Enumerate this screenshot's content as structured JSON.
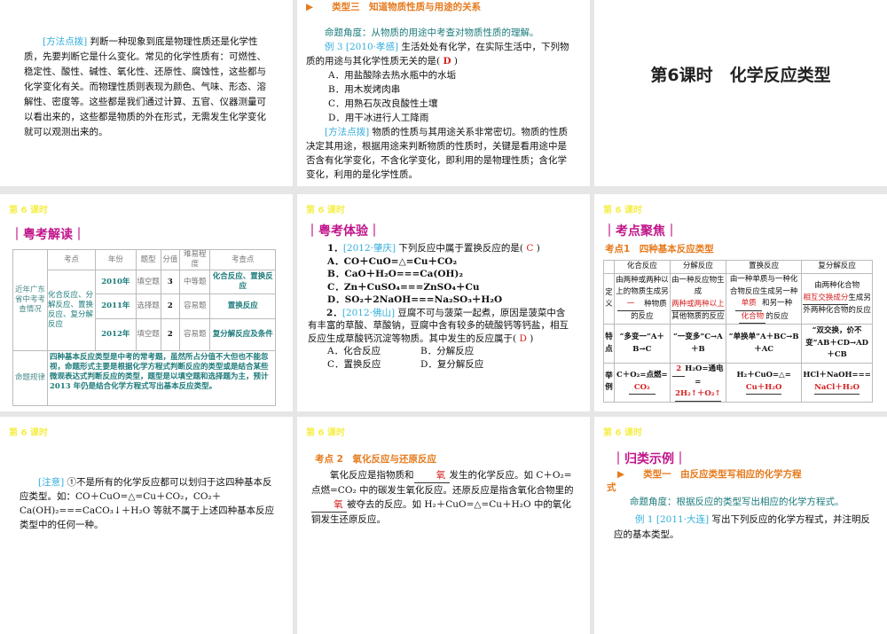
{
  "slide1": {
    "tag": "[方法点拨]",
    "text": "判断一种现象到底是物理性质还是化学性质，先要判断它是什么变化。常见的化学性质有：可燃性、稳定性、酸性、碱性、氧化性、还原性、腐蚀性，这些都与化学变化有关。而物理性质则表现为颜色、气味、形态、溶解性、密度等。这些都是我们通过计算、五官、仪器测量可以看出来的，这些都是物质的外在形式，无需发生化学变化就可以观测出来的。"
  },
  "slide2": {
    "arrow": "▶",
    "type_title": "类型三　知道物质性质与用途的关系",
    "angle": "命题角度：从物质的用途中考查对物质性质的理解。",
    "ex_tag": "例 3 [2010·孝感]",
    "ex_text": "生活处处有化学，在实际生活中，下列物质的用途与其化学性质无关的是(",
    "answer": "D",
    "close": ")",
    "options": [
      "A．用盐酸除去热水瓶中的水垢",
      "B．用木炭烤肉串",
      "C．用熟石灰改良酸性土壤",
      "D．用干冰进行人工降雨"
    ],
    "tag": "[方法点拨]",
    "method": "物质的性质与其用途关系非常密切。物质的性质决定其用途，根据用途来判断物质的性质时，关键是看用途中是否含有化学变化，不含化学变化，即利用的是物理性质；含化学变化，利用的是化学性质。"
  },
  "slide3": {
    "title": "第6课时　化学反应类型"
  },
  "header": "第 6 课时",
  "slide4": {
    "section": "｜粤考解读｜",
    "cols": [
      "考点",
      "年份",
      "题型",
      "分值",
      "难易程度",
      "考查点"
    ],
    "row_label": "近年广东省中考考查情况",
    "points": "化合反应、分解反应、置换反应、复分解反应",
    "rows": [
      [
        "2010年",
        "填空题",
        "3",
        "中等题",
        "化合反应、置换反应"
      ],
      [
        "2011年",
        "选择题",
        "2",
        "容易题",
        "置换反应"
      ],
      [
        "2012年",
        "填空题",
        "2",
        "容易题",
        "复分解反应及条件"
      ]
    ],
    "rule_label": "命题规律",
    "rule": "四种基本反应类型是中考的常考题，虽然所占分值不大但也不能忽视，命题形式主要是根据化学方程式判断反应的类型或是结合某些微观表达式判断反应的类型，题型是以填空题和选择题为主，预计 2013 年仍是结合化学方程式写出基本反应类型。"
  },
  "slide5": {
    "section": "｜粤考体验｜",
    "q1_num": "1．",
    "q1_tag": "[2012·肇庆]",
    "q1_text": "下列反应中属于置换反应的是(",
    "q1_ans": "C",
    "close": ")",
    "q1_opts": [
      "A．CO＋CuO=△=Cu＋CO₂",
      "B．CaO＋H₂O===Ca(OH)₂",
      "C．Zn＋CuSO₄===ZnSO₄＋Cu",
      "D．SO₂＋2NaOH===Na₂SO₃＋H₂O"
    ],
    "q2_num": "2．",
    "q2_tag": "[2012·佛山]",
    "q2_text": "豆腐不可与菠菜一起煮，原因是菠菜中含有丰富的草酸、草酸钠，豆腐中含有较多的硫酸钙等钙盐，相互反应生成草酸钙沉淀等物质。其中发生的反应属于(",
    "q2_ans": "D",
    "q2_opts": [
      "A．化合反应",
      "B．分解反应",
      "C．置换反应",
      "D．复分解反应"
    ]
  },
  "slide6": {
    "section": "｜考点聚焦｜",
    "sub": "考点1　四种基本反应类型",
    "cols": [
      "化合反应",
      "分解反应",
      "置换反应",
      "复分解反应"
    ],
    "row_labels": [
      "定义",
      "特点",
      "举例"
    ],
    "def": [
      [
        "由两种或两种以上的物质生成另",
        "一",
        "种物质的反应"
      ],
      [
        "由一种反应物生成",
        "两种或两种以上",
        "其他物质的反应"
      ],
      [
        "由一种单质与一种化合物反应生成另一种",
        "单质",
        "和另一种",
        "化合物",
        "的反应"
      ],
      [
        "由两种化合物",
        "相互交换成分",
        "生成另外两种化合物的反应"
      ]
    ],
    "feat": [
      "“多变一”A＋B→C",
      "“一变多”C→A＋B",
      "“单换单”A＋BC→B＋AC",
      "“双交换，价不变”AB＋CD→AD＋CB"
    ],
    "ex": [
      [
        "C＋O₂=点燃=",
        "CO₂"
      ],
      [
        "2",
        "H₂O=通电=",
        "2H₂↑＋O₂↑"
      ],
      [
        "H₂＋CuO=△=",
        "Cu＋H₂O"
      ],
      [
        "HCl＋NaOH===",
        "NaCl＋H₂O"
      ]
    ]
  },
  "slide7": {
    "tag": "[注意]",
    "text": "①不是所有的化学反应都可以划归于这四种基本反应类型。如：CO＋CuO=△=Cu＋CO₂，CO₂＋Ca(OH)₂===CaCO₃↓＋H₂O 等就不属于上述四种基本反应类型中的任何一种。"
  },
  "slide8": {
    "sub": "考点 2　氧化反应与还原反应",
    "t1": "氧化反应是指物质和",
    "b1": "氧",
    "t2": "发生的化学反应。如 C＋O₂=点燃=CO₂ 中的碳发生氧化反应。还原反应是指含氧化合物里的",
    "b2": "氧",
    "t3": "被夺去的反应。如 H₂＋CuO=△=Cu＋H₂O 中的氧化铜发生还原反应。"
  },
  "slide9": {
    "section": "｜归类示例｜",
    "arrow": "▶",
    "type_title": "类型一　由反应类型写相应的化学方程式",
    "angle": "命题角度：根据反应的类型写出相应的化学方程式。",
    "ex_tag": "例 1 [2011·大连]",
    "ex_text": "写出下列反应的化学方程式，并注明反应的基本类型。"
  }
}
